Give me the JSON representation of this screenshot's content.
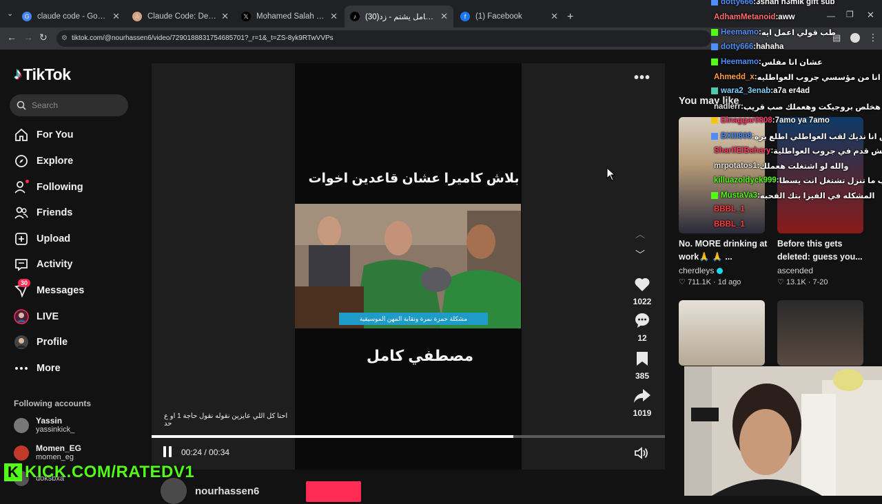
{
  "browser": {
    "tabs": [
      {
        "title": "claude code - Google Search",
        "favicon": "google-icon",
        "color": "#4285f4"
      },
      {
        "title": "Claude Code: Deep coding at te",
        "favicon": "anthropic-icon",
        "color": "#d4a27f"
      },
      {
        "title": "Mohamed Salah (@MoSalah) /",
        "favicon": "x-icon",
        "color": "#000000"
      },
      {
        "title": "(30)مصطفي كامل يشتم - زد",
        "favicon": "tiktok-icon",
        "color": "#000000",
        "active": true
      },
      {
        "title": "(1) Facebook",
        "favicon": "facebook-icon",
        "color": "#1877f2"
      }
    ],
    "new_tab": "+",
    "url": "tiktok.com/@nourhassen6/video/7290188831754685701?_r=1&_t=ZS-8yk9RTwVVPs"
  },
  "sidebar": {
    "logo": "TikTok",
    "search_placeholder": "Search",
    "nav": [
      {
        "label": "For You",
        "icon": "home-icon"
      },
      {
        "label": "Explore",
        "icon": "compass-icon"
      },
      {
        "label": "Following",
        "icon": "following-icon"
      },
      {
        "label": "Friends",
        "icon": "friends-icon"
      },
      {
        "label": "Upload",
        "icon": "upload-icon"
      },
      {
        "label": "Activity",
        "icon": "activity-icon"
      },
      {
        "label": "Messages",
        "icon": "messages-icon",
        "badge": "30"
      },
      {
        "label": "LIVE",
        "icon": "live-icon"
      },
      {
        "label": "Profile",
        "icon": "profile-icon"
      },
      {
        "label": "More",
        "icon": "more-icon"
      }
    ],
    "following_title": "Following accounts",
    "accounts": [
      {
        "name": "Yassin",
        "username": "yassinkick_"
      },
      {
        "name": "Momen_EG",
        "username": "momen_eg"
      },
      {
        "name": "",
        "username": "doksbxa"
      }
    ]
  },
  "video": {
    "top_caption": "بلاش كاميرا عشان قاعدين اخوات",
    "clip_banner": "مشكلة حمزة نمرة ونقابة المهن الموسيقية",
    "bottom_caption": "مصطفي كامل",
    "subtitle": "احنا كل اللي عايزين نقوله نقول حاجة 1 او ع حد",
    "time": "00:24 / 00:34",
    "progress": 0.705,
    "likes": "1022",
    "comments": "12",
    "saves": "385",
    "shares": "1019",
    "author": "nourhassen6"
  },
  "recommendations": {
    "title": "You may like",
    "items": [
      {
        "title": "No. MORE drinking at work🙏 🙏 ...",
        "author": "cherdleys",
        "verified": true,
        "likes": "711.1K",
        "age": "1d ago"
      },
      {
        "title": "Before this gets deleted: guess you...",
        "author": "ascended",
        "verified": false,
        "likes": "13.1K",
        "age": "7-20"
      }
    ]
  },
  "chat": [
    {
      "user": "dotty666",
      "color": "#4f8ef7",
      "msg": "3shan n3mik gift sub",
      "badge": "#4f8ef7"
    },
    {
      "user": "AdhamMetanoid",
      "color": "#ff6b6b",
      "msg": "aww",
      "badge": ""
    },
    {
      "user": "Heemamo",
      "color": "#4f8ef7",
      "msg": "طب قولي اعمل ايه",
      "badge": "#53fc18"
    },
    {
      "user": "dotty666",
      "color": "#4f8ef7",
      "msg": "hahaha",
      "badge": "#4f8ef7"
    },
    {
      "user": "Heemamo",
      "color": "#4f8ef7",
      "msg": "عشان انا مفلس",
      "badge": "#53fc18"
    },
    {
      "user": "Ahmedd_x",
      "color": "#ff9a3c",
      "msg": "انا من مؤسسي جروب العواطليه",
      "badge": ""
    },
    {
      "user": "wara2_3enab",
      "color": "#7fd1ff",
      "msg": "a7a er4ad",
      "badge": "#4ec9b0"
    },
    {
      "user": "nadlerr",
      "color": "#e0e0e0",
      "msg": "يسطا انا هخلص بروجيكت وهعملك صب قريب",
      "badge": ""
    },
    {
      "user": "Elnaggar0808",
      "color": "#ff3b6b",
      "msg": "7amo ya 7amo",
      "badge": "#f5c518"
    },
    {
      "user": "BXIII808",
      "color": "#4f8ef7",
      "msg": "مستحقش انا نديك لقب العواطلي اطلع بره",
      "badge": "#4f8ef7"
    },
    {
      "user": "SharifElBahary",
      "color": "#ff3b6b",
      "msg": "حش قدم في جروب العواطلية",
      "badge": ""
    },
    {
      "user": "mrpotatos1",
      "color": "#e0e0e0",
      "msg": "والله لو اشتغلت هعملك",
      "badge": ""
    },
    {
      "user": "killuazoldyck999",
      "color": "#53fc18",
      "msg": "طب ما تنزل تشتغل انت يسطا",
      "badge": ""
    },
    {
      "user": "MustaVa3",
      "color": "#53fc18",
      "msg": "المشكله في الفيزا بتك الفحبه",
      "badge": "#53fc18"
    },
    {
      "user": "BBBL_1",
      "color": "#ff3b3b",
      "msg": "",
      "badge": ""
    },
    {
      "user": "BBBL_1",
      "color": "#ff3b3b",
      "msg": "",
      "badge": ""
    }
  ],
  "watermark": "KICK.COM/RATEDV1"
}
